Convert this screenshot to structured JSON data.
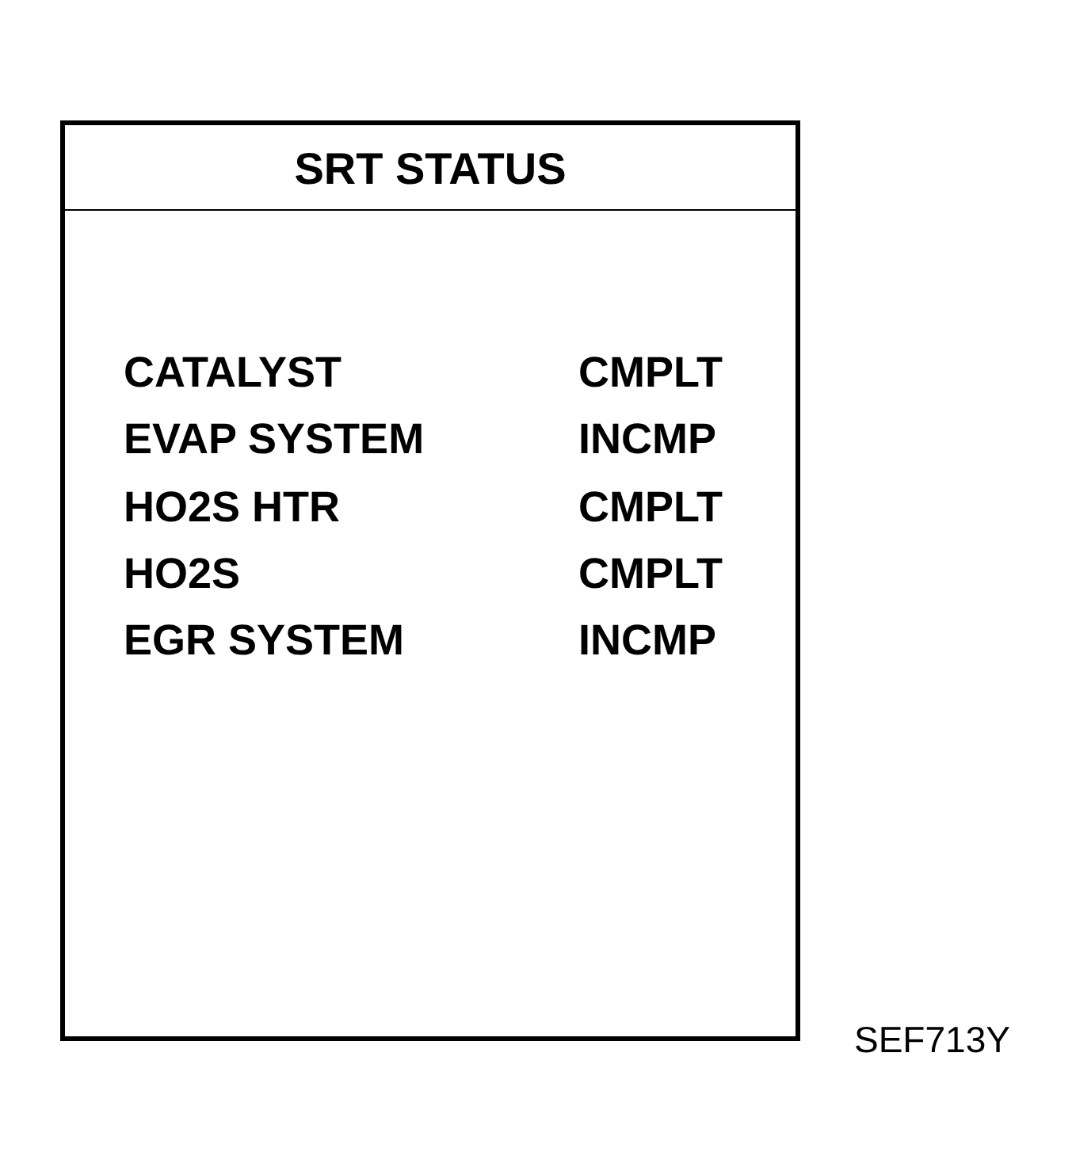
{
  "panel": {
    "title": "SRT STATUS",
    "items": [
      {
        "name": "CATALYST",
        "status": "CMPLT"
      },
      {
        "name": "EVAP SYSTEM",
        "status": "INCMP"
      },
      {
        "name": "HO2S HTR",
        "status": "CMPLT"
      },
      {
        "name": "HO2S",
        "status": "CMPLT"
      },
      {
        "name": "EGR SYSTEM",
        "status": "INCMP"
      }
    ]
  },
  "figure_code": "SEF713Y"
}
